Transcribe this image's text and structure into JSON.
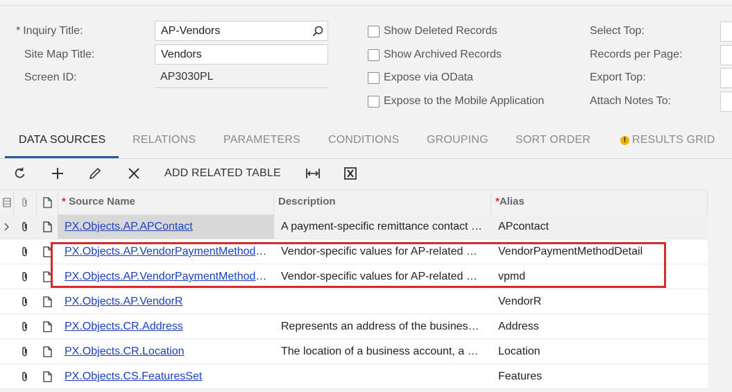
{
  "form": {
    "inquiry_title_label": "Inquiry Title:",
    "inquiry_title_value": "AP-Vendors",
    "site_map_title_label": "Site Map Title:",
    "site_map_title_value": "Vendors",
    "screen_id_label": "Screen ID:",
    "screen_id_value": "AP3030PL",
    "required_mark": "*",
    "checkboxes": [
      {
        "label": "Show Deleted Records",
        "checked": false
      },
      {
        "label": "Show Archived Records",
        "checked": false
      },
      {
        "label": "Expose via OData",
        "checked": false
      },
      {
        "label": "Expose to the Mobile Application",
        "checked": false
      }
    ],
    "right_labels": [
      "Select Top:",
      "Records per Page:",
      "Export Top:",
      "Attach Notes To:"
    ]
  },
  "tabs": [
    "DATA SOURCES",
    "RELATIONS",
    "PARAMETERS",
    "CONDITIONS",
    "GROUPING",
    "SORT ORDER",
    "RESULTS GRID"
  ],
  "toolbar": {
    "refresh_icon": "refresh-icon",
    "add_icon": "plus-icon",
    "edit_icon": "pencil-icon",
    "delete_icon": "close-icon",
    "add_related_label": "ADD RELATED TABLE",
    "fit_icon": "fit-columns-icon",
    "excel_icon": "excel-export-icon"
  },
  "grid": {
    "headers": {
      "source_name": "Source Name",
      "description": "Description",
      "alias": "Alias",
      "required_mark": "*"
    },
    "rows": [
      {
        "source": "PX.Objects.AP.APContact",
        "description": "A payment-specific remittance contact for AP documents",
        "alias": "APcontact",
        "selected": true
      },
      {
        "source": "PX.Objects.AP.VendorPaymentMethodDetail",
        "description": "Vendor-specific values for AP-related payment method settings",
        "alias": "VendorPaymentMethodDetail",
        "selected": false
      },
      {
        "source": "PX.Objects.AP.VendorPaymentMethodDetail",
        "description": "Vendor-specific values for AP-related payment method settings",
        "alias": "vpmd",
        "selected": false
      },
      {
        "source": "PX.Objects.AP.VendorR",
        "description": "",
        "alias": "VendorR",
        "selected": false
      },
      {
        "source": "PX.Objects.CR.Address",
        "description": "Represents an address of the business account",
        "alias": "Address",
        "selected": false
      },
      {
        "source": "PX.Objects.CR.Location",
        "description": "The location of a business account, a vendor or a customer",
        "alias": "Location",
        "selected": false
      },
      {
        "source": "PX.Objects.CS.FeaturesSet",
        "description": "",
        "alias": "Features",
        "selected": false
      }
    ]
  },
  "colors": {
    "accent": "#1f5c99",
    "link": "#1a3fbf",
    "highlight": "#d9262b",
    "warning": "#f0b400"
  }
}
